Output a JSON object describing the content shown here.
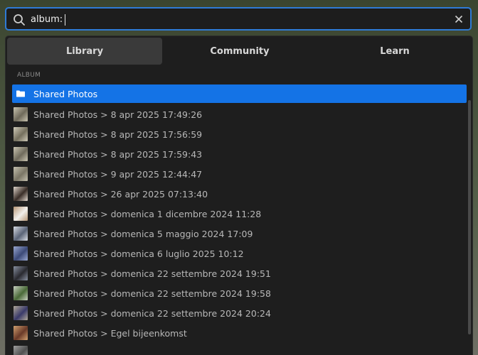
{
  "search": {
    "value": "album:",
    "clear_icon": "close-icon"
  },
  "tabs": [
    {
      "label": "Library",
      "active": true
    },
    {
      "label": "Community",
      "active": false
    },
    {
      "label": "Learn",
      "active": false
    }
  ],
  "section_label": "ALBUM",
  "results": [
    {
      "label": "Shared Photos",
      "icon": "folder-icon",
      "selected": true
    },
    {
      "label": "Shared Photos > 8 apr 2025 17:49:26",
      "thumb_colors": [
        "#6f6a5a",
        "#c9c4b0"
      ]
    },
    {
      "label": "Shared Photos > 8 apr 2025 17:56:59",
      "thumb_colors": [
        "#75705e",
        "#cfcab8"
      ]
    },
    {
      "label": "Shared Photos > 8 apr 2025 17:59:43",
      "thumb_colors": [
        "#706b5c",
        "#cac5b2"
      ]
    },
    {
      "label": "Shared Photos > 9 apr 2025 12:44:47",
      "thumb_colors": [
        "#7a7565",
        "#c4c0ae"
      ]
    },
    {
      "label": "Shared Photos > 26 apr 2025 07:13:40",
      "thumb_colors": [
        "#3a2e28",
        "#e0d6cc"
      ]
    },
    {
      "label": "Shared Photos > domenica 1 dicembre 2024 11:28",
      "thumb_colors": [
        "#f2f0ec",
        "#b89878"
      ]
    },
    {
      "label": "Shared Photos > domenica 5 maggio 2024 17:09",
      "thumb_colors": [
        "#5a6478",
        "#d8dce4"
      ]
    },
    {
      "label": "Shared Photos > domenica 6 luglio 2025 10:12",
      "thumb_colors": [
        "#3c4a78",
        "#9aa8d0"
      ]
    },
    {
      "label": "Shared Photos > domenica 22 settembre 2024 19:51",
      "thumb_colors": [
        "#2a2a30",
        "#8890a0"
      ]
    },
    {
      "label": "Shared Photos > domenica 22 settembre 2024 19:58",
      "thumb_colors": [
        "#4a6a38",
        "#c8d0c0"
      ]
    },
    {
      "label": "Shared Photos > domenica 22 settembre 2024 20:24",
      "thumb_colors": [
        "#3a3a6a",
        "#b0a898"
      ]
    },
    {
      "label": "Shared Photos > Egel bijeenkomst",
      "thumb_colors": [
        "#6a3a28",
        "#d0a070"
      ]
    },
    {
      "label": "",
      "thumb_colors": [
        "#505050",
        "#a0a0a0"
      ]
    }
  ]
}
